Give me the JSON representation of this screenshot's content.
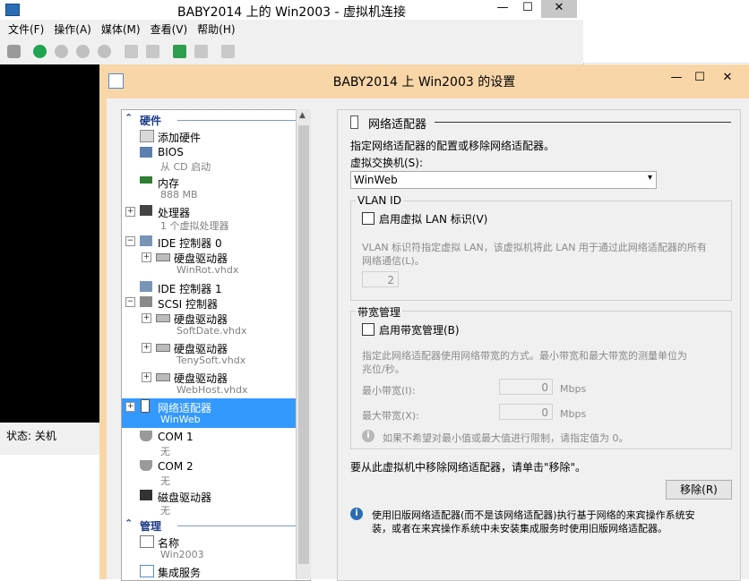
{
  "vm_window": {
    "title": "BABY2014 上的 Win2003 - 虚拟机连接",
    "menu": [
      "文件(F)",
      "操作(A)",
      "媒体(M)",
      "查看(V)",
      "帮助(H)"
    ],
    "status_label": "状态: 关机",
    "controls": {
      "minimize": "—",
      "maximize": "☐",
      "close": "✕"
    }
  },
  "dialog": {
    "title": "BABY2014 上 Win2003 的设置",
    "controls": {
      "minimize": "—",
      "maximize": "☐",
      "close": "✕"
    }
  },
  "tree": {
    "section_hardware": "硬件",
    "section_management": "管理",
    "items": [
      {
        "label": "添加硬件",
        "sub": ""
      },
      {
        "label": "BIOS",
        "sub": "从 CD 启动"
      },
      {
        "label": "内存",
        "sub": "888 MB"
      },
      {
        "label": "处理器",
        "sub": "1 个虚拟处理器"
      },
      {
        "label": "IDE 控制器 0",
        "sub": ""
      },
      {
        "label": "硬盘驱动器",
        "sub": "WinRot.vhdx"
      },
      {
        "label": "IDE 控制器 1",
        "sub": ""
      },
      {
        "label": "SCSI 控制器",
        "sub": ""
      },
      {
        "label": "硬盘驱动器",
        "sub": "SoftDate.vhdx"
      },
      {
        "label": "硬盘驱动器",
        "sub": "TenySoft.vhdx"
      },
      {
        "label": "硬盘驱动器",
        "sub": "WebHost.vhdx"
      },
      {
        "label": "网络适配器",
        "sub": "WinWeb"
      },
      {
        "label": "COM 1",
        "sub": "无"
      },
      {
        "label": "COM 2",
        "sub": "无"
      },
      {
        "label": "磁盘驱动器",
        "sub": "无"
      },
      {
        "label": "名称",
        "sub": "Win2003"
      },
      {
        "label": "集成服务",
        "sub": ""
      }
    ]
  },
  "panel": {
    "header": "网络适配器",
    "description": "指定网络适配器的配置或移除网络适配器。",
    "switch_label": "虚拟交换机(S):",
    "switch_value": "WinWeb",
    "vlan": {
      "group": "VLAN ID",
      "checkbox": "启用虚拟 LAN 标识(V)",
      "checked": false,
      "help_line1": "VLAN 标识符指定虚拟 LAN，该虚拟机将此 LAN 用于通过此网络适配器的所有",
      "help_line2": "网络通信(L)。",
      "value": "2"
    },
    "bandwidth": {
      "group": "带宽管理",
      "checkbox": "启用带宽管理(B)",
      "checked": false,
      "help_line1": "指定此网络适配器使用网络带宽的方式。最小带宽和最大带宽的测量单位为",
      "help_line2": "兆位/秒。",
      "min_label": "最小带宽(I):",
      "min_value": "0",
      "max_label": "最大带宽(X):",
      "max_value": "0",
      "unit": "Mbps",
      "note": "如果不希望对最小值或最大值进行限制，请指定值为 0。"
    },
    "remove_text": "要从此虚拟机中移除网络适配器，请单击\"移除\"。",
    "remove_button": "移除(R)",
    "info_line1": "使用旧版网络适配器(而不是该网络适配器)执行基于网络的来宾操作系统安",
    "info_line2": "装，或者在来宾操作系统中未安装集成服务时使用旧版网络适配器。"
  },
  "colors": {
    "selection": "#3399ff",
    "section_header": "#1b3c88",
    "dialog_frame": "#f8d6a8"
  }
}
